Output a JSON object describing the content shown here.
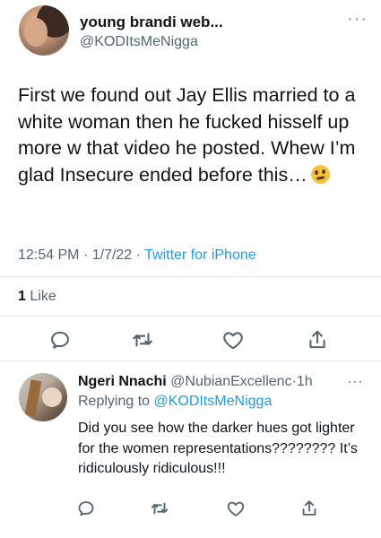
{
  "tweet": {
    "display_name": "young brandi web...",
    "handle": "@KODItsMeNigga",
    "more_label": "···",
    "text": "First we found out Jay Ellis married to a white woman then he fucked hisself up more w that video he posted. Whew I’m glad Insecure ended before this…",
    "emoji": "woozy-face-emoji",
    "time": "12:54 PM",
    "date": "1/7/22",
    "source": "Twitter for iPhone",
    "separator": "·",
    "like_count": "1",
    "like_label": "Like"
  },
  "actions": {
    "icons": [
      "reply-icon",
      "retweet-icon",
      "like-icon",
      "share-icon"
    ]
  },
  "reply": {
    "display_name": "Ngeri Nnachi",
    "handle": "@NubianExcellenc",
    "separator": "·",
    "time": "1h",
    "more_label": "···",
    "replying_to_label": "Replying to",
    "replying_to_handle": "@KODItsMeNigga",
    "text": "Did you see how the darker hues got lighter for the women representations???????? It’s ridiculously ridiculous!!!"
  },
  "colors": {
    "accent": "#1d9bf0",
    "secondary_text": "#536471",
    "primary_text": "#0f1419",
    "divider": "#e6ecf0"
  }
}
